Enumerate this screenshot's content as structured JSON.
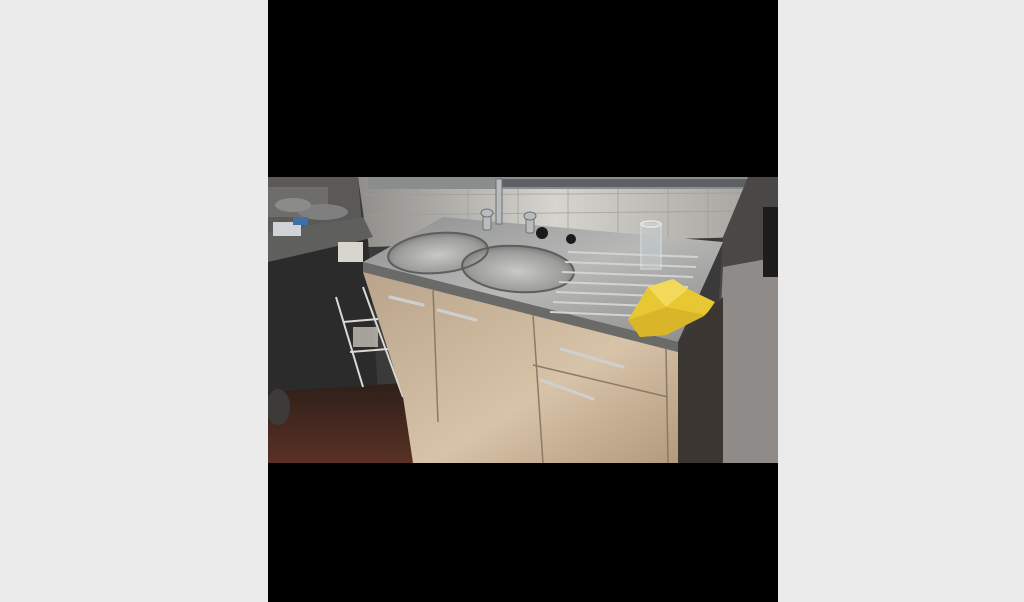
{
  "viewer": {
    "background_color": "#ebebeb",
    "letterbox_color": "#000000"
  },
  "photo": {
    "subject_icons": [
      "kitchen-sink-icon",
      "dish-rack-icon",
      "cabinet-icon",
      "yellow-cloth-icon",
      "glass-icon",
      "faucet-icon"
    ],
    "colors": {
      "wall_tile": "#cfcdc8",
      "stainless_steel": "#a9aaa8",
      "cabinet_wood": "#cdb79c",
      "cloth_yellow": "#e8c832",
      "floor": "#4b2a20"
    }
  }
}
